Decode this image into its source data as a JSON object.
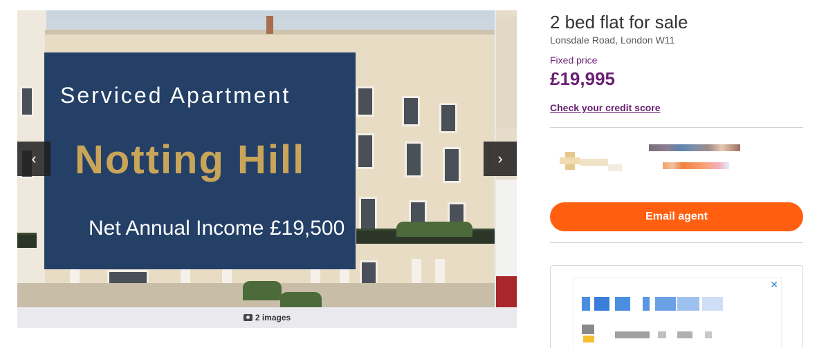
{
  "gallery": {
    "overlay_title": "Serviced Apartment",
    "overlay_name": "Notting Hill",
    "overlay_income": "Net Annual Income £19,500",
    "prev_icon": "‹",
    "next_icon": "›",
    "image_count": "2 images"
  },
  "listing": {
    "title": "2 bed flat for sale",
    "address": "Lonsdale Road, London W11",
    "price_qualifier": "Fixed price",
    "price": "£19,995",
    "credit_link": "Check your credit score"
  },
  "agent": {
    "email_button": "Email agent"
  },
  "ad": {
    "close_icon": "✕"
  },
  "colors": {
    "accent_purple": "#6a1f73",
    "cta_orange": "#ff5f0f",
    "overlay_navy": "#163460",
    "overlay_gold": "#c9a55a"
  }
}
